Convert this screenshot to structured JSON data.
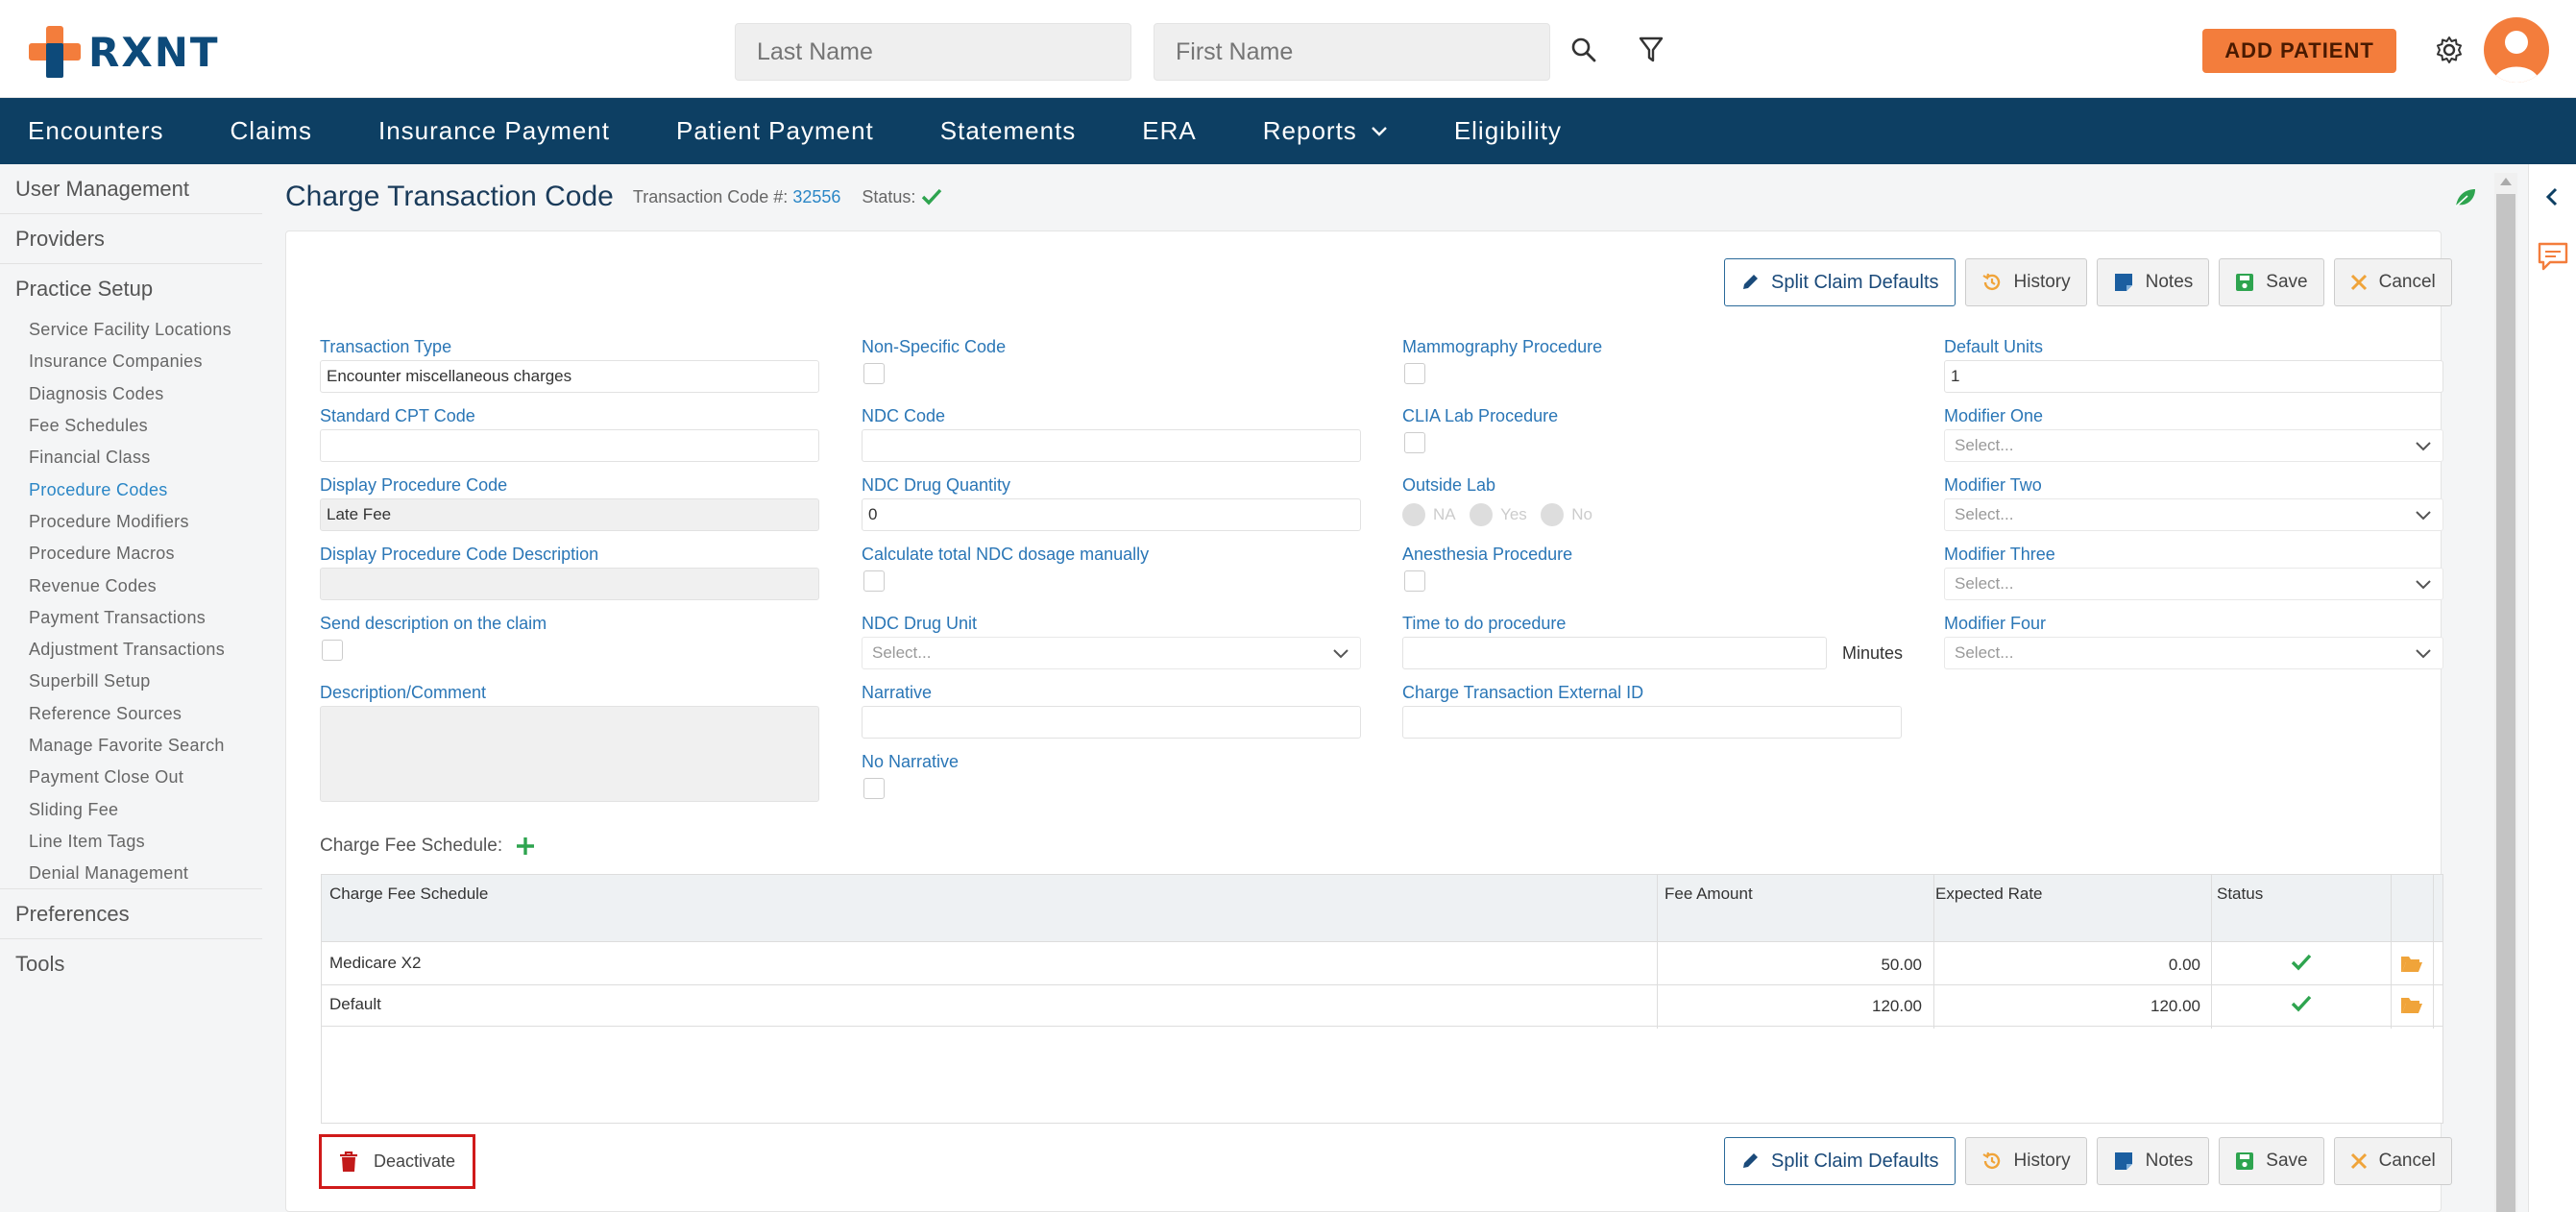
{
  "header": {
    "logo_text": "RXNT",
    "last_name_placeholder": "Last Name",
    "first_name_placeholder": "First Name",
    "add_patient_label": "ADD PATIENT"
  },
  "nav": {
    "items": [
      "Encounters",
      "Claims",
      "Insurance Payment",
      "Patient Payment",
      "Statements",
      "ERA",
      "Reports",
      "Eligibility"
    ]
  },
  "sidebar": {
    "sections": [
      "User Management",
      "Providers",
      "Practice Setup",
      "Preferences",
      "Tools"
    ],
    "items": [
      "Service Facility Locations",
      "Insurance Companies",
      "Diagnosis Codes",
      "Fee Schedules",
      "Financial Class",
      "Procedure Codes",
      "Procedure Modifiers",
      "Procedure Macros",
      "Revenue Codes",
      "Payment Transactions",
      "Adjustment Transactions",
      "Superbill Setup",
      "Reference Sources",
      "Manage Favorite Search",
      "Payment Close Out",
      "Sliding Fee",
      "Line Item Tags",
      "Denial Management"
    ],
    "active_item": "Procedure Codes"
  },
  "page": {
    "title": "Charge Transaction Code",
    "code_label": "Transaction Code #:",
    "code_value": "32556",
    "status_label": "Status:"
  },
  "toolbar": {
    "split_label": "Split Claim Defaults",
    "history_label": "History",
    "notes_label": "Notes",
    "save_label": "Save",
    "cancel_label": "Cancel"
  },
  "form": {
    "transaction_type_label": "Transaction Type",
    "transaction_type_value": "Encounter miscellaneous charges",
    "standard_cpt_label": "Standard CPT Code",
    "standard_cpt_value": "",
    "display_code_label": "Display Procedure Code",
    "display_code_value": "Late Fee",
    "display_desc_label": "Display Procedure Code Description",
    "send_desc_label": "Send description on the claim",
    "desc_comment_label": "Description/Comment",
    "non_specific_label": "Non-Specific Code",
    "ndc_code_label": "NDC Code",
    "ndc_qty_label": "NDC Drug Quantity",
    "ndc_qty_value": "0",
    "calc_ndc_label": "Calculate total NDC dosage manually",
    "ndc_unit_label": "NDC Drug Unit",
    "ndc_unit_placeholder": "Select...",
    "narrative_label": "Narrative",
    "no_narrative_label": "No Narrative",
    "mammo_label": "Mammography Procedure",
    "clia_label": "CLIA Lab Procedure",
    "outside_lab_label": "Outside Lab",
    "outside_lab_options": [
      "NA",
      "Yes",
      "No"
    ],
    "anesthesia_label": "Anesthesia Procedure",
    "time_label": "Time to do procedure",
    "minutes_label": "Minutes",
    "external_id_label": "Charge Transaction External ID",
    "default_units_label": "Default Units",
    "default_units_value": "1",
    "modifier_one_label": "Modifier One",
    "modifier_two_label": "Modifier Two",
    "modifier_three_label": "Modifier Three",
    "modifier_four_label": "Modifier Four",
    "select_placeholder": "Select..."
  },
  "fee_schedule": {
    "label": "Charge Fee Schedule:",
    "columns": [
      "Charge Fee Schedule",
      "Fee Amount",
      "Expected Rate",
      "Status"
    ],
    "rows": [
      {
        "name": "Medicare X2",
        "fee": "50.00",
        "rate": "0.00"
      },
      {
        "name": "Default",
        "fee": "120.00",
        "rate": "120.00"
      }
    ]
  },
  "footer": {
    "deactivate_label": "Deactivate"
  },
  "colors": {
    "brand_navy": "#0d3f63",
    "accent_orange": "#f37d3c",
    "link_blue": "#2a76b6",
    "success_green": "#2ea44f",
    "danger_red": "#d01a1a"
  }
}
